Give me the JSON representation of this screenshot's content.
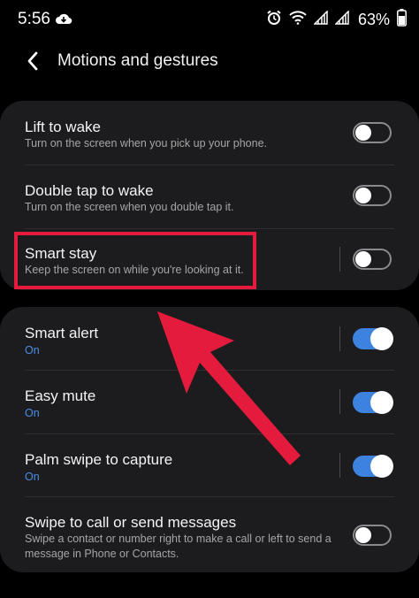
{
  "status_bar": {
    "time": "5:56",
    "battery": "63%"
  },
  "header": {
    "title": "Motions and gestures"
  },
  "group1": {
    "items": [
      {
        "title": "Lift to wake",
        "subtitle": "Turn on the screen when you pick up your phone.",
        "enabled": false
      },
      {
        "title": "Double tap to wake",
        "subtitle": "Turn on the screen when you double tap it.",
        "enabled": false
      },
      {
        "title": "Smart stay",
        "subtitle": "Keep the screen on while you're looking at it.",
        "enabled": false
      }
    ]
  },
  "group2": {
    "items": [
      {
        "title": "Smart alert",
        "subtitle": "On",
        "enabled": true
      },
      {
        "title": "Easy mute",
        "subtitle": "On",
        "enabled": true
      },
      {
        "title": "Palm swipe to capture",
        "subtitle": "On",
        "enabled": true
      },
      {
        "title": "Swipe to call or send messages",
        "subtitle_line1": "Swipe a contact or number right to make a call or left to send a",
        "subtitle_line2": "message in Phone or Contacts.",
        "enabled": false
      }
    ]
  },
  "colors": {
    "accent": "#3e82e0",
    "annotation": "#e41b3c",
    "card": "#1c1c1e"
  }
}
